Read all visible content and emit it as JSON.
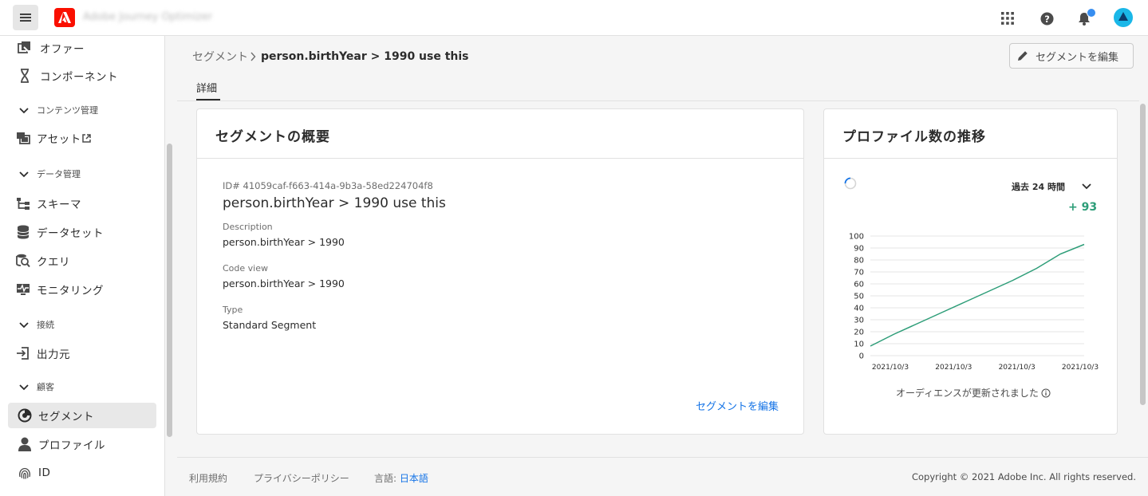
{
  "header": {
    "app_title": "Adobe Journey Optimizer"
  },
  "sidebar": {
    "items": [
      {
        "label": "オファー"
      },
      {
        "label": "コンポーネント"
      },
      {
        "section": "コンテンツ管理"
      },
      {
        "label": "アセット"
      },
      {
        "section": "データ管理"
      },
      {
        "label": "スキーマ"
      },
      {
        "label": "データセット"
      },
      {
        "label": "クエリ"
      },
      {
        "label": "モニタリング"
      },
      {
        "section": "接続"
      },
      {
        "label": "出力元"
      },
      {
        "section": "顧客"
      },
      {
        "label": "セグメント",
        "selected": true
      },
      {
        "label": "プロファイル"
      },
      {
        "label": "ID"
      }
    ]
  },
  "breadcrumb": {
    "parent": "セグメント",
    "current": "person.birthYear > 1990 use this"
  },
  "actions": {
    "edit_segment": "セグメントを編集"
  },
  "tabs": [
    {
      "label": "詳細",
      "active": true
    }
  ],
  "overview": {
    "title": "セグメントの概要",
    "id_text": "ID# 41059caf-f663-414a-9b3a-58ed224704f8",
    "name": "person.birthYear > 1990 use this",
    "fields": [
      {
        "label": "Description",
        "value": "person.birthYear > 1990"
      },
      {
        "label": "Code view",
        "value": "person.birthYear > 1990"
      },
      {
        "label": "Type",
        "value": "Standard Segment"
      }
    ],
    "edit_link": "セグメントを編集"
  },
  "trend": {
    "title": "プロファイル数の推移",
    "period": "過去 24 時間",
    "delta": "+ 93",
    "note": "オーディエンスが更新されました"
  },
  "chart_data": {
    "type": "line",
    "x": [
      "2021/10/3",
      "2021/10/3",
      "2021/10/3",
      "2021/10/3"
    ],
    "series": [
      {
        "values": [
          8,
          18,
          27,
          36,
          45,
          54,
          63,
          73,
          85,
          93
        ]
      }
    ],
    "yticks": [
      0,
      10,
      20,
      30,
      40,
      50,
      60,
      70,
      80,
      90,
      100
    ],
    "ylim": [
      0,
      100
    ],
    "grid": true,
    "color": "#2d9d78"
  },
  "footer": {
    "terms": "利用規約",
    "privacy": "プライバシーポリシー",
    "language_label": "言語:",
    "language_value": "日本語",
    "copyright": "Copyright ©  2021 Adobe Inc.  All rights reserved."
  }
}
